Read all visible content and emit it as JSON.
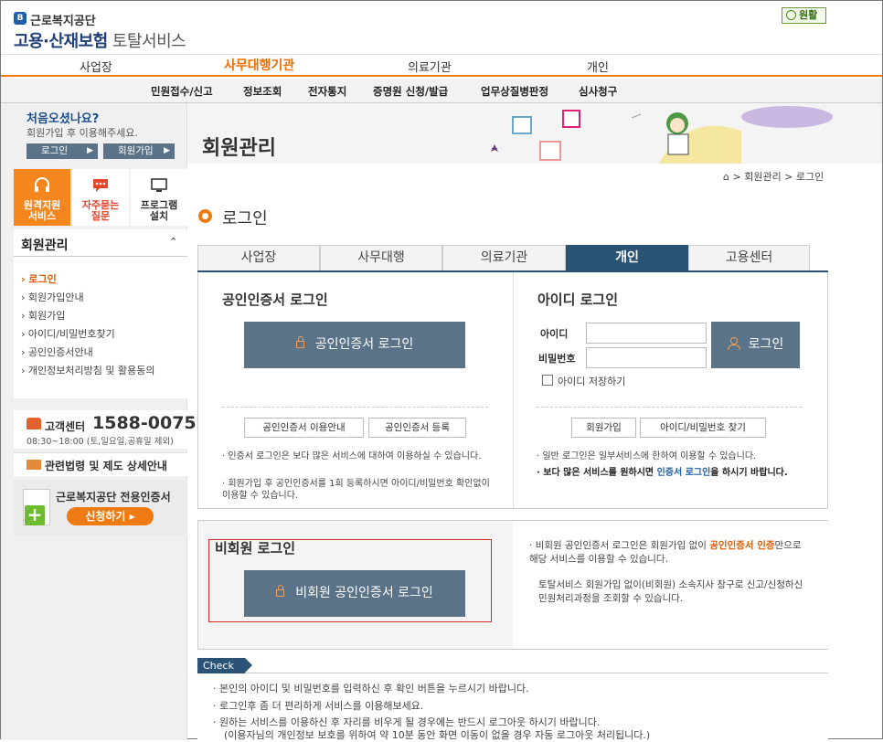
{
  "header": {
    "org_name": "근로복지공단",
    "service_main": "고용·산재보험",
    "service_sub": " 토탈서비스",
    "status": "원활"
  },
  "topnav": [
    "사업장",
    "사무대행기관",
    "의료기관",
    "개인"
  ],
  "topnav_active": "사무대행기관",
  "subnav": [
    "민원접수/신고",
    "정보조회",
    "전자통지",
    "증명원 신청/발급",
    "업무상질병판정",
    "심사청구"
  ],
  "sidebar": {
    "welcome_title": "처음오셨나요?",
    "welcome_sub": "회원가입 후 이용해주세요.",
    "login_btn": "로그인",
    "join_btn": "회원가입",
    "quick": [
      {
        "label1": "원격지원",
        "label2": "서비스"
      },
      {
        "label1": "자주묻는",
        "label2": "질문"
      },
      {
        "label1": "프로그램",
        "label2": "설치"
      }
    ],
    "menu_title": "회원관리",
    "menu_items": [
      "로그인",
      "회원가입안내",
      "회원가입",
      "아이디/비밀번호찾기",
      "공인인증서안내",
      "개인정보처리방침 및 활용동의"
    ],
    "menu_active": "로그인",
    "cs_label": "고객센터",
    "cs_phone": "1588-0075",
    "cs_hours": "08:30~18:00 (토,일요일,공휴일 제외)",
    "law_label": "관련법령 및 제도 상세안내",
    "cert_label": "근로복지공단 전용인증서",
    "cert_apply": "신청하기"
  },
  "main": {
    "page_title": "회원관리",
    "breadcrumb": [
      "회원관리",
      "로그인"
    ],
    "section_title": "로그인",
    "tabs": [
      "사업장",
      "사무대행",
      "의료기관",
      "개인",
      "고용센터"
    ],
    "active_tab": "개인",
    "cert_login": {
      "title": "공인인증서 로그인",
      "button": "공인인증서 로그인",
      "guide_btn": "공인인증서 이용안내",
      "register_btn": "공인인증서 등록",
      "note1": "인증서 로그인은 보다 많은 서비스에 대하여 이용하실 수 있습니다.",
      "note2": "회원가입 후 공인인증서를 1회 등록하시면 아이디/비밀번호 확인없이 이용할 수 있습니다."
    },
    "id_login": {
      "title": "아이디 로그인",
      "id_label": "아이디",
      "pw_label": "비밀번호",
      "id_value": "",
      "pw_value": "",
      "button": "로그인",
      "save_id": "아이디 저장하기",
      "join_btn": "회원가입",
      "find_btn": "아이디/비밀번호 찾기",
      "note1": "일반 로그인은 일부서비스에 한하여 이용할 수 있습니다.",
      "note2_a": "보다 많은 서비스를 원하시면 ",
      "note2_b": "인증서 로그인",
      "note2_c": "을 하시기 바랍니다."
    },
    "guest": {
      "title": "비회원 로그인",
      "button": "비회원 공인인증서 로그인",
      "info1_a": "비회원 공인인증서 로그인은 회원가입 없이 ",
      "info1_b": "공인인증서 인증",
      "info1_c": "만으로 해당 서비스를 이용할 수 있습니다.",
      "info2": "토탈서비스 회원가입 없이(비회원) 소속지사 창구로 신고/신청하신 민원처리과정을 조회할 수 있습니다."
    },
    "check": {
      "tag": "Check",
      "items": [
        "본인의 아이디 및 비밀번호를 입력하신 후 확인 버튼을 누르시기 바랍니다.",
        "로그인후 좀 더 편리하게 서비스를 이용해보세요.",
        "원하는 서비스를 이용하신 후 자리를 비우게 될 경우에는 반드시 로그아웃 하시기 바랍니다.",
        "(이용자님의 개인정보 보호를 위하여 약 10분 동안 화면 이동이 없을 경우 자동 로그아웃 처리됩니다.)"
      ]
    }
  },
  "colors": {
    "accent": "#f07a12",
    "tab_active": "#2b5376",
    "button": "#5b7389",
    "highlight": "#d92a2a"
  }
}
